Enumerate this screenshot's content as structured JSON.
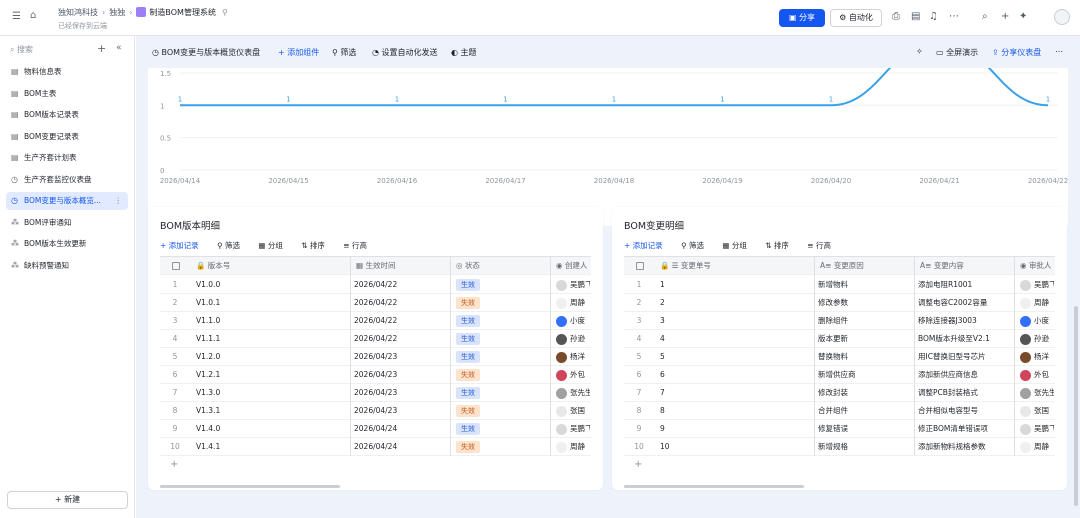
{
  "colors": {
    "accent": "#1456f0",
    "line": "#3aa0e8",
    "active_bg": "#e1eaff",
    "tag_ok": "#d9e4fb",
    "tag_bad": "#fde2cc"
  },
  "topbar": {
    "breadcrumbs": [
      "独知鸿科技",
      "独独",
      "制造BOM管理系统"
    ],
    "saved": "已经保存到云端",
    "share_label": "分享",
    "automation_label": "自动化"
  },
  "sidebar": {
    "search_placeholder": "搜索",
    "items": [
      {
        "label": "物料信息表",
        "icon": "table-icon"
      },
      {
        "label": "BOM主表",
        "icon": "table-icon"
      },
      {
        "label": "BOM版本记录表",
        "icon": "table-icon"
      },
      {
        "label": "BOM变更记录表",
        "icon": "table-icon"
      },
      {
        "label": "生产齐套计划表",
        "icon": "table-icon"
      },
      {
        "label": "生产齐套监控仪表盘",
        "icon": "dashboard-icon"
      },
      {
        "label": "BOM变更与版本概览...",
        "icon": "dashboard-icon",
        "active": true
      },
      {
        "label": "BOM评审通知",
        "icon": "workflow-icon"
      },
      {
        "label": "BOM版本生效更新",
        "icon": "workflow-icon"
      },
      {
        "label": "缺料预警通知",
        "icon": "workflow-icon"
      }
    ],
    "new_label": "新建"
  },
  "dashboard": {
    "title": "BOM变更与版本概览仪表盘",
    "add_component": "添加组件",
    "filter": "筛选",
    "auto_send": "设置自动化发送",
    "theme": "主题",
    "fullscreen": "全屏演示",
    "share_dash": "分享仪表盘"
  },
  "chart_data": {
    "type": "line",
    "x": [
      "2026/04/14",
      "2026/04/15",
      "2026/04/16",
      "2026/04/17",
      "2026/04/18",
      "2026/04/19",
      "2026/04/20",
      "2026/04/21",
      "2026/04/22"
    ],
    "y_visible": [
      1,
      1,
      1,
      1,
      1,
      1,
      1,
      2,
      1
    ],
    "data_labels": [
      "1",
      "1",
      "1",
      "1",
      "1",
      "1",
      "1",
      "",
      "1"
    ],
    "yticks": [
      "0",
      "0.5",
      "1",
      "1.5"
    ],
    "ylim": [
      0,
      1.7
    ],
    "grid": true
  },
  "version_card": {
    "title": "BOM版本明细",
    "tools": [
      "添加记录",
      "筛选",
      "分组",
      "排序",
      "行高"
    ],
    "columns": [
      "版本号",
      "生效时间",
      "状态",
      "创建人"
    ],
    "rows": [
      {
        "n": "1",
        "v": "V1.0.0",
        "d": "2026/04/22",
        "s": "生效",
        "p": "吴鹏飞"
      },
      {
        "n": "2",
        "v": "V1.0.1",
        "d": "2026/04/22",
        "s": "失效",
        "p": "周静"
      },
      {
        "n": "3",
        "v": "V1.1.0",
        "d": "2026/04/22",
        "s": "生效",
        "p": "小度"
      },
      {
        "n": "4",
        "v": "V1.1.1",
        "d": "2026/04/22",
        "s": "生效",
        "p": "孙逊"
      },
      {
        "n": "5",
        "v": "V1.2.0",
        "d": "2026/04/23",
        "s": "生效",
        "p": "杨洋"
      },
      {
        "n": "6",
        "v": "V1.2.1",
        "d": "2026/04/23",
        "s": "失效",
        "p": "外包"
      },
      {
        "n": "7",
        "v": "V1.3.0",
        "d": "2026/04/23",
        "s": "生效",
        "p": "张先生"
      },
      {
        "n": "8",
        "v": "V1.3.1",
        "d": "2026/04/23",
        "s": "失效",
        "p": "张国"
      },
      {
        "n": "9",
        "v": "V1.4.0",
        "d": "2026/04/24",
        "s": "生效",
        "p": "吴鹏飞"
      },
      {
        "n": "10",
        "v": "V1.4.1",
        "d": "2026/04/24",
        "s": "失效",
        "p": "周静"
      }
    ]
  },
  "change_card": {
    "title": "BOM变更明细",
    "tools": [
      "添加记录",
      "筛选",
      "分组",
      "排序",
      "行高"
    ],
    "columns": [
      "变更单号",
      "变更原因",
      "变更内容",
      "审批人"
    ],
    "rows": [
      {
        "n": "1",
        "id": "1",
        "r": "新增物料",
        "c": "添加电阻R1001",
        "p": "吴鹏飞"
      },
      {
        "n": "2",
        "id": "2",
        "r": "修改参数",
        "c": "调整电容C2002容量",
        "p": "周静"
      },
      {
        "n": "3",
        "id": "3",
        "r": "删除组件",
        "c": "移除连接器J3003",
        "p": "小度"
      },
      {
        "n": "4",
        "id": "4",
        "r": "版本更新",
        "c": "BOM版本升级至V2.1",
        "p": "孙逊"
      },
      {
        "n": "5",
        "id": "5",
        "r": "替换物料",
        "c": "用IC替换旧型号芯片",
        "p": "杨洋"
      },
      {
        "n": "6",
        "id": "6",
        "r": "新增供应商",
        "c": "添加新供应商信息",
        "p": "外包"
      },
      {
        "n": "7",
        "id": "7",
        "r": "修改封装",
        "c": "调整PCB封装格式",
        "p": "张先生"
      },
      {
        "n": "8",
        "id": "8",
        "r": "合并组件",
        "c": "合并相似电容型号",
        "p": "张国"
      },
      {
        "n": "9",
        "id": "9",
        "r": "修复错误",
        "c": "修正BOM清单错误项",
        "p": "吴鹏飞"
      },
      {
        "n": "10",
        "id": "10",
        "r": "新增规格",
        "c": "添加新物料规格参数",
        "p": "周静"
      }
    ]
  }
}
